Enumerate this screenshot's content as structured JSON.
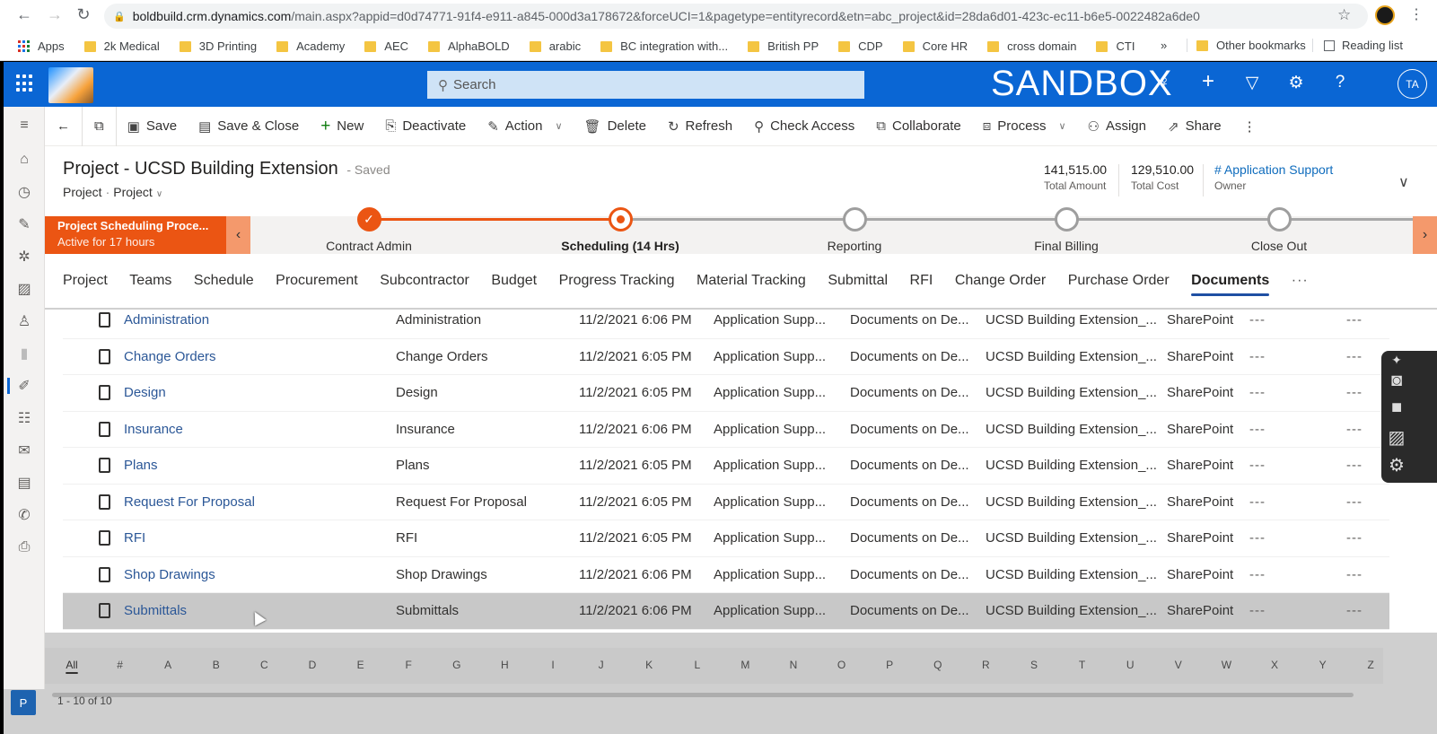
{
  "browser": {
    "url_host": "boldbuild.crm.dynamics.com",
    "url_path": "/main.aspx?appid=d0d74771-91f4-e911-a845-000d3a178672&forceUCI=1&pagetype=entityrecord&etn=abc_project&id=28da6d01-423c-ec11-b6e5-0022482a6de0",
    "bookmarks": [
      "Apps",
      "2k Medical",
      "3D Printing",
      "Academy",
      "AEC",
      "AlphaBOLD",
      "arabic",
      "BC integration with...",
      "British PP",
      "CDP",
      "Core HR",
      "cross domain",
      "CTI"
    ],
    "overflow": "»",
    "other_bookmarks": "Other bookmarks",
    "reading_list": "Reading list"
  },
  "topbar": {
    "search_placeholder": "Search",
    "environment": "SANDBOX",
    "avatar_initials": "TA"
  },
  "commands": [
    {
      "label": "Save",
      "icon": "save-icon",
      "glyph": "▣"
    },
    {
      "label": "Save & Close",
      "icon": "save-close-icon",
      "glyph": "▤"
    },
    {
      "label": "New",
      "icon": "plus-icon",
      "glyph": "+"
    },
    {
      "label": "Deactivate",
      "icon": "deactivate-icon",
      "glyph": "⎘"
    },
    {
      "label": "Action",
      "icon": "action-icon",
      "glyph": "✎",
      "dropdown": true
    },
    {
      "label": "Delete",
      "icon": "trash-icon",
      "glyph": "🗑"
    },
    {
      "label": "Refresh",
      "icon": "refresh-icon",
      "glyph": "↻"
    },
    {
      "label": "Check Access",
      "icon": "key-icon",
      "glyph": "⚲"
    },
    {
      "label": "Collaborate",
      "icon": "teams-icon",
      "glyph": "⧉"
    },
    {
      "label": "Process",
      "icon": "process-icon",
      "glyph": "⧈",
      "dropdown": true
    },
    {
      "label": "Assign",
      "icon": "assign-icon",
      "glyph": "⚇"
    },
    {
      "label": "Share",
      "icon": "share-icon",
      "glyph": "⇗"
    }
  ],
  "record": {
    "title": "Project - UCSD Building Extension",
    "save_status": "- Saved",
    "entity": "Project",
    "form": "Project",
    "total_amount": "141,515.00",
    "total_amount_label": "Total Amount",
    "total_cost": "129,510.00",
    "total_cost_label": "Total Cost",
    "owner": "# Application Support",
    "owner_label": "Owner"
  },
  "bpf": {
    "name": "Project Scheduling Proce...",
    "active_for": "Active for 17 hours",
    "stages": [
      {
        "label": "Contract Admin",
        "status": "done"
      },
      {
        "label": "Scheduling  (14 Hrs)",
        "status": "active"
      },
      {
        "label": "Reporting",
        "status": "pending"
      },
      {
        "label": "Final Billing",
        "status": "pending"
      },
      {
        "label": "Close Out",
        "status": "pending"
      }
    ]
  },
  "tabs": [
    "Project",
    "Teams",
    "Schedule",
    "Procurement",
    "Subcontractor",
    "Budget",
    "Progress Tracking",
    "Material Tracking",
    "Submittal",
    "RFI",
    "Change Order",
    "Purchase Order",
    "Documents"
  ],
  "selected_tab": "Documents",
  "tabs_more": "···",
  "documents": [
    {
      "name": "Administration",
      "folder": "Administration",
      "modified": "11/2/2021 6:06 PM",
      "modified_by": "Application Supp...",
      "library": "Documents on De...",
      "path": "UCSD Building Extension_...",
      "source": "SharePoint",
      "c1": "---",
      "c2": "---"
    },
    {
      "name": "Change Orders",
      "folder": "Change Orders",
      "modified": "11/2/2021 6:05 PM",
      "modified_by": "Application Supp...",
      "library": "Documents on De...",
      "path": "UCSD Building Extension_...",
      "source": "SharePoint",
      "c1": "---",
      "c2": "---"
    },
    {
      "name": "Design",
      "folder": "Design",
      "modified": "11/2/2021 6:05 PM",
      "modified_by": "Application Supp...",
      "library": "Documents on De...",
      "path": "UCSD Building Extension_...",
      "source": "SharePoint",
      "c1": "---",
      "c2": "---"
    },
    {
      "name": "Insurance",
      "folder": "Insurance",
      "modified": "11/2/2021 6:06 PM",
      "modified_by": "Application Supp...",
      "library": "Documents on De...",
      "path": "UCSD Building Extension_...",
      "source": "SharePoint",
      "c1": "---",
      "c2": "---"
    },
    {
      "name": "Plans",
      "folder": "Plans",
      "modified": "11/2/2021 6:05 PM",
      "modified_by": "Application Supp...",
      "library": "Documents on De...",
      "path": "UCSD Building Extension_...",
      "source": "SharePoint",
      "c1": "---",
      "c2": "---"
    },
    {
      "name": "Request For Proposal",
      "folder": "Request For Proposal",
      "modified": "11/2/2021 6:05 PM",
      "modified_by": "Application Supp...",
      "library": "Documents on De...",
      "path": "UCSD Building Extension_...",
      "source": "SharePoint",
      "c1": "---",
      "c2": "---"
    },
    {
      "name": "RFI",
      "folder": "RFI",
      "modified": "11/2/2021 6:05 PM",
      "modified_by": "Application Supp...",
      "library": "Documents on De...",
      "path": "UCSD Building Extension_...",
      "source": "SharePoint",
      "c1": "---",
      "c2": "---"
    },
    {
      "name": "Shop Drawings",
      "folder": "Shop Drawings",
      "modified": "11/2/2021 6:06 PM",
      "modified_by": "Application Supp...",
      "library": "Documents on De...",
      "path": "UCSD Building Extension_...",
      "source": "SharePoint",
      "c1": "---",
      "c2": "---"
    },
    {
      "name": "Submittals",
      "folder": "Submittals",
      "modified": "11/2/2021 6:06 PM",
      "modified_by": "Application Supp...",
      "library": "Documents on De...",
      "path": "UCSD Building Extension_...",
      "source": "SharePoint",
      "c1": "---",
      "c2": "---"
    }
  ],
  "hovered_row": 8,
  "jumpbar": [
    "All",
    "#",
    "A",
    "B",
    "C",
    "D",
    "E",
    "F",
    "G",
    "H",
    "I",
    "J",
    "K",
    "L",
    "M",
    "N",
    "O",
    "P",
    "Q",
    "R",
    "S",
    "T",
    "U",
    "V",
    "W",
    "X",
    "Y",
    "Z"
  ],
  "pager": "1 - 10 of 10",
  "area_switcher": "P",
  "colors": {
    "brand_blue": "#0a66d4",
    "bpf_orange": "#eb5513",
    "link_blue": "#2b5797"
  }
}
